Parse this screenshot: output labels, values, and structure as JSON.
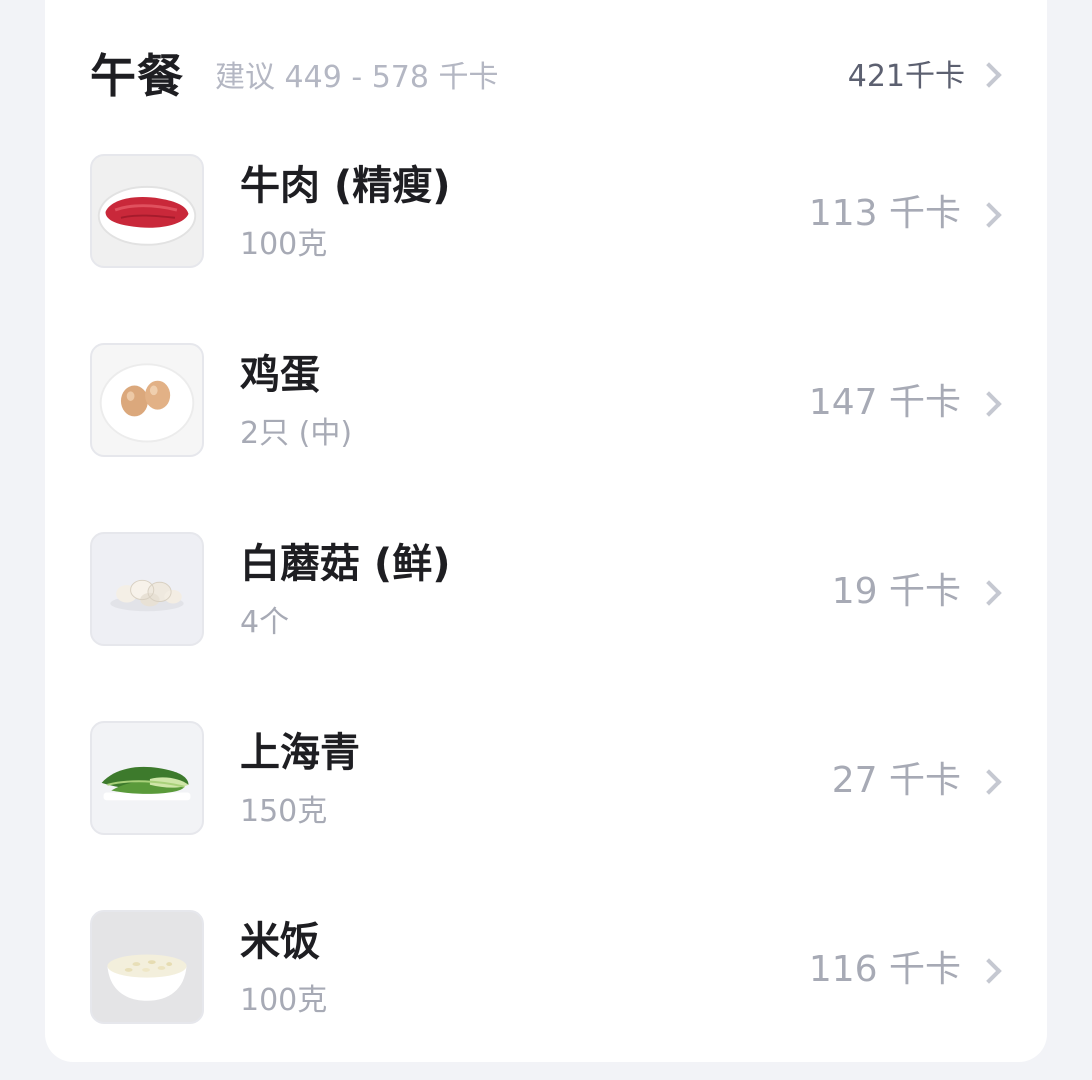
{
  "meal": {
    "title": "午餐",
    "suggestion": "建议 449 - 578 千卡",
    "total": "421千卡"
  },
  "items": [
    {
      "name": "牛肉 (精瘦)",
      "quantity": "100克",
      "kcal": "113 千卡",
      "icon": "beef-image"
    },
    {
      "name": "鸡蛋",
      "quantity": "2只 (中)",
      "kcal": "147 千卡",
      "icon": "egg-image"
    },
    {
      "name": "白蘑菇 (鲜)",
      "quantity": "4个",
      "kcal": "19 千卡",
      "icon": "mushroom-image"
    },
    {
      "name": "上海青",
      "quantity": "150克",
      "kcal": "27 千卡",
      "icon": "bok-choy-image"
    },
    {
      "name": "米饭",
      "quantity": "100克",
      "kcal": "116 千卡",
      "icon": "rice-image"
    }
  ]
}
